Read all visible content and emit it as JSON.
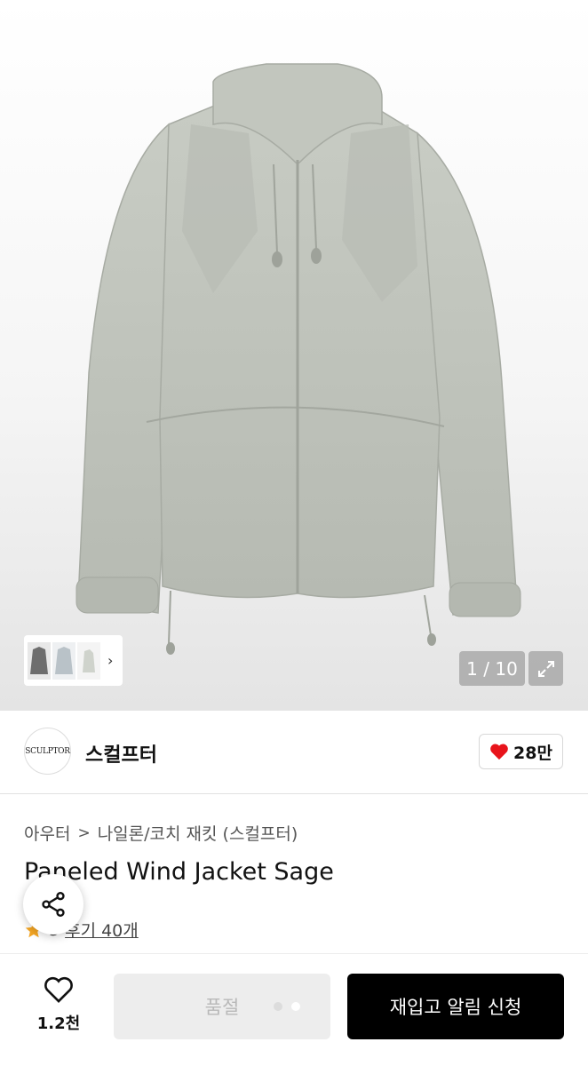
{
  "gallery": {
    "counter": "1 / 10",
    "thumbnail_more": "›"
  },
  "brand": {
    "logo_text": "SCULPTOR",
    "name": "스컬프터",
    "likes": "28만"
  },
  "product": {
    "breadcrumb": [
      "아우터",
      "나일론/코치 재킷 (스컬프터)"
    ],
    "breadcrumb_separator": ">",
    "title": "Paneled Wind Jacket Sage",
    "rating": "5",
    "reviews": "후기 40개"
  },
  "actions": {
    "wish_count": "1.2천",
    "soldout_label": "품절",
    "restock_label": "재입고 알림 신청"
  },
  "icons": {
    "share": "share-icon",
    "heart": "heart-icon",
    "expand": "expand-icon",
    "star": "star-icon",
    "chevron": "chevron-right-icon"
  },
  "colors": {
    "jacket": "#bfc3bb",
    "heart_red": "#e8141b",
    "star": "#f5a623",
    "primary_button": "#000000"
  }
}
